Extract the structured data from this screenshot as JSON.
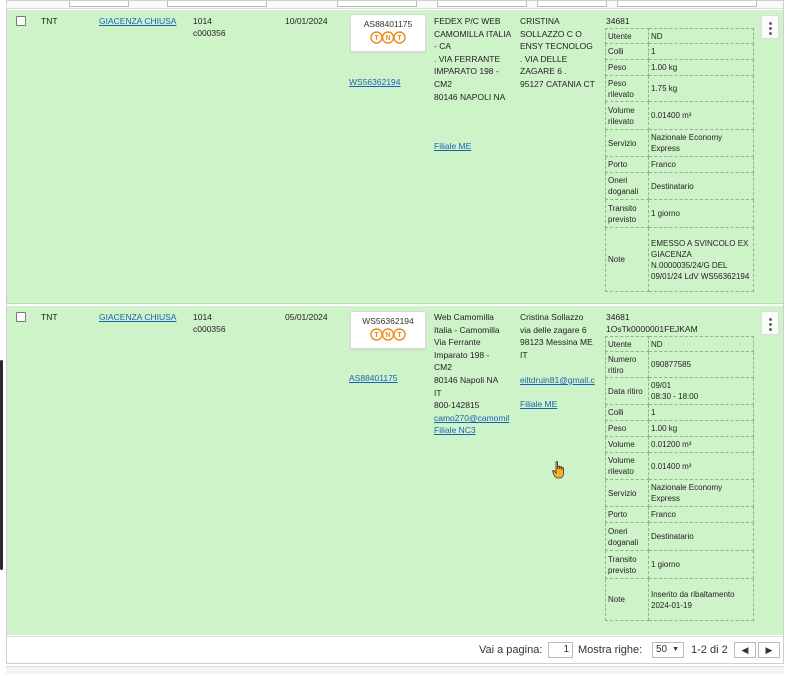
{
  "pagination": {
    "goto_label": "Vai a pagina:",
    "page_value": "1",
    "rows_label": "Mostra righe:",
    "rows_value": "50",
    "range_text": "1-2 di 2"
  },
  "rows": [
    {
      "carrier": "TNT",
      "status": "GIACENZA CHIUSA",
      "code1": "1014",
      "code2": "c000356",
      "date": "10/01/2024",
      "box_code": "AS88401175",
      "logo_text": "TNT",
      "ref_link": "WS56362194",
      "sender_lines": [
        "FEDEX P/C WEB",
        "CAMOMILLA ITALIA",
        "- CA",
        ". VIA FERRANTE",
        "IMPARATO 198 -",
        "CM2",
        "80146 NAPOLI NA"
      ],
      "sender_filiale": "Filiale ME",
      "recipient_lines": [
        "CRISTINA",
        "SOLLAZZO C O",
        "ENSY TECNOLOG",
        ". VIA DELLE",
        "ZAGARE 6 .",
        "95127 CATANIA CT"
      ],
      "details_header": "34681",
      "details": [
        {
          "k": "Utente",
          "v": "ND"
        },
        {
          "k": "Colli",
          "v": "1"
        },
        {
          "k": "Peso",
          "v": "1.00 kg"
        },
        {
          "k": "Peso rilevato",
          "v": "1.75 kg"
        },
        {
          "k": "Volume rilevato",
          "v": "0.01400 m³"
        },
        {
          "k": "Servizio",
          "v": "Nazionale Economy Express"
        },
        {
          "k": "Porto",
          "v": "Franco"
        },
        {
          "k": "Oneri doganali",
          "v": "Destinatario"
        },
        {
          "k": "Transito previsto",
          "v": "1 giorno"
        },
        {
          "k": "Note",
          "v": "EMESSO A SVINCOLO EX GIACENZA N.0000035/24/G DEL 09/01/24 LdV WS56362194"
        }
      ]
    },
    {
      "carrier": "TNT",
      "status": "GIACENZA CHIUSA",
      "code1": "1014",
      "code2": "c000356",
      "date": "05/01/2024",
      "box_code": "WS56362194",
      "logo_text": "TNT",
      "ref_link": "AS88401175",
      "sender_lines": [
        "Web Camomilla",
        "Italia - Camomilla",
        "Via Ferrante",
        "Imparato 198 -",
        "CM2",
        "80146 Napoli NA",
        "IT",
        "800-142815"
      ],
      "sender_email": "camo270@camomil",
      "sender_filiale": "Filiale NC3",
      "recipient_lines": [
        "Cristina Sollazzo",
        "via delle zagare 6",
        "98123 Messina ME",
        "IT"
      ],
      "recipient_email": "eiltdruin81@gmail.c",
      "recipient_filiale": "Filiale ME",
      "details_header": "34681",
      "details_header2": "1OsTk0000001FEJKAM",
      "details": [
        {
          "k": "Utente",
          "v": "ND"
        },
        {
          "k": "Numero ritiro",
          "v": "090877585"
        },
        {
          "k": "Data ritiro",
          "v": "09/01\n08:30 - 18:00"
        },
        {
          "k": "Colli",
          "v": "1"
        },
        {
          "k": "Peso",
          "v": "1.00 kg"
        },
        {
          "k": "Volume",
          "v": "0.01200 m³"
        },
        {
          "k": "Volume rilevato",
          "v": "0.01400 m³"
        },
        {
          "k": "Servizio",
          "v": "Nazionale Economy Express"
        },
        {
          "k": "Porto",
          "v": "Franco"
        },
        {
          "k": "Oneri doganali",
          "v": "Destinatario"
        },
        {
          "k": "Transito previsto",
          "v": "1 giorno"
        },
        {
          "k": "Note",
          "v": "Inserito da ribaltamento 2024-01-19"
        }
      ]
    }
  ],
  "icons": {
    "checkbox": "checkbox-icon",
    "menu": "kebab-menu-icon",
    "prev": "chevron-left-icon",
    "next": "chevron-right-icon",
    "dropdown": "caret-down-icon",
    "cursor": "hand-pointer-icon"
  },
  "colors": {
    "row_bg": "#cff3c9",
    "link": "#1a62b5",
    "tnt_orange": "#f08a1c"
  }
}
